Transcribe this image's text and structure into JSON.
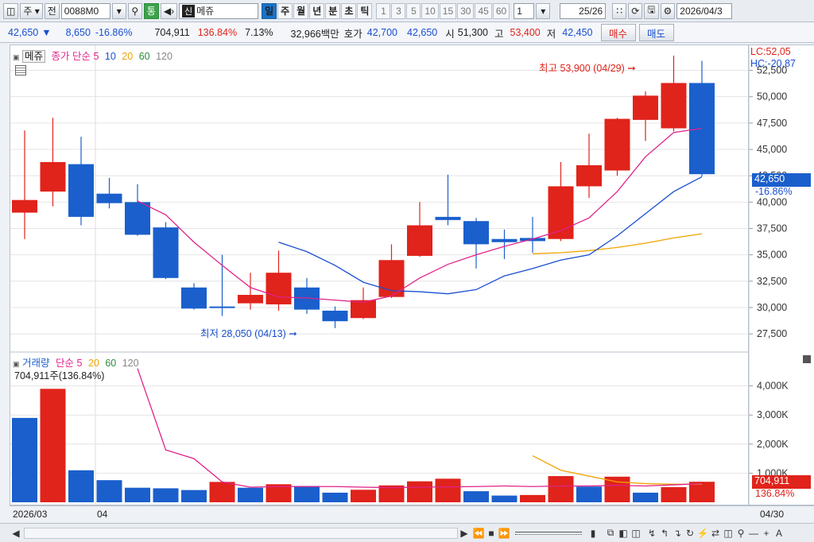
{
  "toolbar": {
    "market": "주",
    "market_type": "전",
    "code": "0088M0",
    "search_icon": "search-icon",
    "mode": "통",
    "sound_icon": "speaker-icon",
    "credit_badge": "신",
    "stock_name": "메쥬",
    "periods": [
      "일",
      "주",
      "월",
      "년",
      "분",
      "초",
      "틱"
    ],
    "active_period": "일",
    "intervals": [
      "1",
      "3",
      "5",
      "10",
      "15",
      "30",
      "45",
      "60"
    ],
    "custom_interval": "1",
    "page_indicator": "25/26",
    "date": "2026/04/3"
  },
  "quote": {
    "price": "42,650",
    "change_arrow": "▼",
    "change": "8,650",
    "change_pct": "-16.86%",
    "volume": "704,911",
    "volume_ratio": "136.84%",
    "turnover_rate": "7.13%",
    "amount": "32,966백만",
    "bid_ask_label": "호가",
    "bid": "42,700",
    "ask": "42,650",
    "open_label": "시",
    "open": "51,300",
    "high_label": "고",
    "high": "53,400",
    "low_label": "저",
    "low": "42,450",
    "buy_label": "매수",
    "sell_label": "매도"
  },
  "price_panel": {
    "title": "메쥬",
    "legend_label": "종가 단순",
    "ma_labels": [
      "5",
      "10",
      "20",
      "60",
      "120"
    ],
    "ma_colors": [
      "#e0238a",
      "#1a4fd0",
      "#f0a400",
      "#2e8a3b",
      "#888888"
    ],
    "high_annotation": "최고 53,900 (04/29)",
    "low_annotation": "최저 28,050 (04/13)",
    "lc_label": "LC:52,05",
    "hc_label": "HC:-20,87",
    "current_price_tag": "42,650",
    "current_pct_tag": "-16.86%"
  },
  "volume_panel": {
    "legend_label": "거래량",
    "ma_legend": "단순",
    "ma_labels": [
      "5",
      "20",
      "60",
      "120"
    ],
    "info": "704,911주(136.84%)",
    "current_volume_tag": "704,911",
    "current_pct_tag": "136.84%"
  },
  "dates": {
    "start": "2026/03",
    "month_mark": "04",
    "end": "04/30"
  },
  "colors": {
    "up": "#e0231b",
    "down": "#1a5fcc",
    "ma5": "#e0238a",
    "ma10": "#1a4fd0",
    "ma20": "#f0a400"
  },
  "chart_data": [
    {
      "type": "candlestick",
      "title": "메쥬",
      "y_ticks": [
        27500,
        30000,
        32500,
        35000,
        37500,
        40000,
        42500,
        45000,
        47500,
        50000,
        52500
      ],
      "ylim": [
        26000,
        54500
      ],
      "candles": [
        {
          "open": 39000,
          "close": 40200,
          "high": 46800,
          "low": 36500
        },
        {
          "open": 41000,
          "close": 43800,
          "high": 48000,
          "low": 39600
        },
        {
          "open": 43600,
          "close": 38600,
          "high": 46200,
          "low": 37800
        },
        {
          "open": 40800,
          "close": 39900,
          "high": 42300,
          "low": 39400
        },
        {
          "open": 40000,
          "close": 36900,
          "high": 41700,
          "low": 36800
        },
        {
          "open": 37600,
          "close": 32800,
          "high": 38100,
          "low": 32700
        },
        {
          "open": 31900,
          "close": 29900,
          "high": 32300,
          "low": 29800
        },
        {
          "open": 30100,
          "close": 30000,
          "high": 35000,
          "low": 29200
        },
        {
          "open": 30400,
          "close": 31200,
          "high": 33300,
          "low": 29800
        },
        {
          "open": 30300,
          "close": 33300,
          "high": 35400,
          "low": 29700
        },
        {
          "open": 31900,
          "close": 29800,
          "high": 32800,
          "low": 29400
        },
        {
          "open": 29700,
          "close": 28700,
          "high": 30100,
          "low": 28050
        },
        {
          "open": 29000,
          "close": 30700,
          "high": 31900,
          "low": 28900
        },
        {
          "open": 31000,
          "close": 34500,
          "high": 36000,
          "low": 30900
        },
        {
          "open": 34900,
          "close": 37800,
          "high": 40000,
          "low": 34800
        },
        {
          "open": 38600,
          "close": 38300,
          "high": 42600,
          "low": 37800
        },
        {
          "open": 38200,
          "close": 36000,
          "high": 38500,
          "low": 33700
        },
        {
          "open": 36500,
          "close": 36200,
          "high": 37400,
          "low": 34600
        },
        {
          "open": 36600,
          "close": 36300,
          "high": 38600,
          "low": 35200
        },
        {
          "open": 36500,
          "close": 41500,
          "high": 43800,
          "low": 36300
        },
        {
          "open": 41500,
          "close": 43500,
          "high": 46500,
          "low": 40400
        },
        {
          "open": 43000,
          "close": 47900,
          "high": 48000,
          "low": 42500
        },
        {
          "open": 47800,
          "close": 50100,
          "high": 50500,
          "low": 45800
        },
        {
          "open": 47000,
          "close": 51300,
          "high": 53900,
          "low": 46700
        },
        {
          "open": 51300,
          "close": 42650,
          "high": 53400,
          "low": 42450
        }
      ],
      "ma5": [
        null,
        null,
        null,
        null,
        40100,
        38800,
        36200,
        34000,
        31900,
        31000,
        30900,
        30700,
        30500,
        31100,
        32800,
        34100,
        35000,
        35800,
        36500,
        37300,
        38500,
        41000,
        44300,
        46600,
        47000
      ],
      "ma10": [
        null,
        null,
        null,
        null,
        null,
        null,
        null,
        null,
        null,
        36200,
        35300,
        34000,
        32400,
        31600,
        31500,
        31300,
        31700,
        33000,
        33700,
        34500,
        35000,
        36800,
        38900,
        41000,
        42400
      ],
      "ma20": [
        null,
        null,
        null,
        null,
        null,
        null,
        null,
        null,
        null,
        null,
        null,
        null,
        null,
        null,
        null,
        null,
        null,
        null,
        35100,
        35200,
        35400,
        35700,
        36100,
        36600,
        37000
      ]
    },
    {
      "type": "bar",
      "title": "거래량",
      "y_ticks": [
        1000,
        2000,
        3000,
        4000
      ],
      "ylim": [
        0,
        4700
      ],
      "volumes": [
        2900,
        3900,
        1100,
        760,
        500,
        480,
        420,
        700,
        500,
        620,
        560,
        330,
        430,
        580,
        720,
        810,
        380,
        230,
        250,
        900,
        540,
        880,
        330,
        520,
        704.911
      ],
      "directions": [
        "down",
        "up",
        "down",
        "down",
        "down",
        "down",
        "down",
        "up",
        "down",
        "up",
        "down",
        "down",
        "up",
        "up",
        "up",
        "up",
        "down",
        "down",
        "up",
        "up",
        "down",
        "up",
        "down",
        "up",
        "up"
      ],
      "ma5": [
        null,
        null,
        null,
        null,
        4600,
        1800,
        1500,
        700,
        520,
        540,
        540,
        540,
        520,
        500,
        520,
        530,
        540,
        560,
        540,
        560,
        560,
        580,
        560,
        600,
        640
      ],
      "ma20": [
        null,
        null,
        null,
        null,
        null,
        null,
        null,
        null,
        null,
        null,
        null,
        null,
        null,
        null,
        null,
        null,
        null,
        null,
        1600,
        1100,
        900,
        700,
        640,
        620,
        620
      ]
    }
  ]
}
